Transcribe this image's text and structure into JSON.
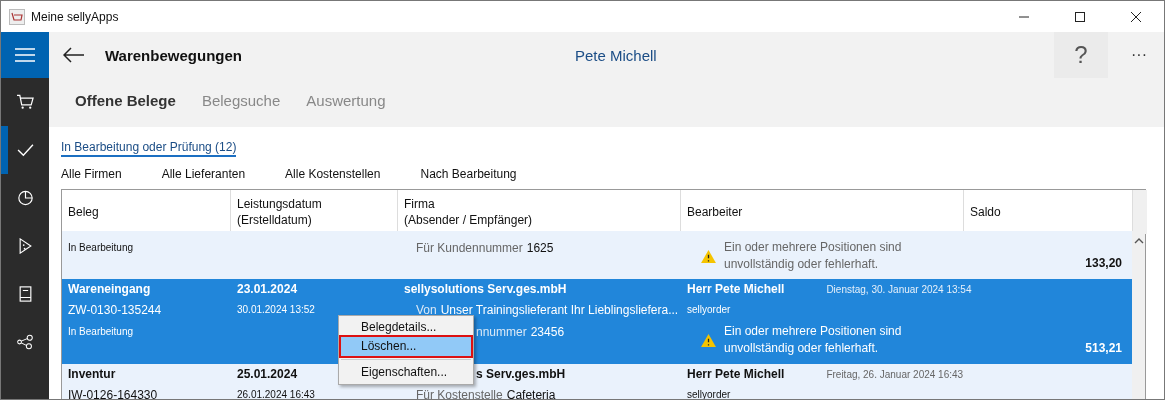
{
  "window": {
    "title": "Meine sellyApps"
  },
  "sidebar": {
    "items": [
      {
        "kind": "menu",
        "selected": false
      },
      {
        "kind": "cart",
        "selected": false
      },
      {
        "kind": "check",
        "selected": true
      },
      {
        "kind": "chart",
        "selected": false
      },
      {
        "kind": "slice",
        "selected": false
      },
      {
        "kind": "book",
        "selected": false
      },
      {
        "kind": "share",
        "selected": false
      }
    ]
  },
  "header": {
    "title": "Warenbewegungen",
    "user": "Pete Michell",
    "help": "?",
    "more": "···"
  },
  "tabs": [
    {
      "label": "Offene Belege",
      "selected": true
    },
    {
      "label": "Belegsuche",
      "selected": false
    },
    {
      "label": "Auswertung",
      "selected": false
    }
  ],
  "view": {
    "label": "In Bearbeitung oder Prüfung (12)"
  },
  "filters": [
    "Alle Firmen",
    "Alle Lieferanten",
    "Alle Kostenstellen",
    "Nach Bearbeitung"
  ],
  "table": {
    "columns": [
      {
        "label": "Beleg"
      },
      {
        "label": "Leistungsdatum",
        "sublabel": "(Erstelldatum)"
      },
      {
        "label": "Firma",
        "sublabel": "(Absender / Empfänger)"
      },
      {
        "label": "Bearbeiter"
      },
      {
        "label": "Saldo"
      }
    ],
    "rows": [
      {
        "selected": false,
        "status": "In Bearbeitung",
        "reference": {
          "label": "Für Kundennummer",
          "value": "1625"
        },
        "warning": "Ein oder mehrere Positionen sind unvollständig oder fehlerhaft.",
        "saldo": "133,20"
      },
      {
        "selected": true,
        "type": "Wareneingang",
        "number": "ZW-0130-135244",
        "status": "In Bearbeitung",
        "date": "23.01.2024",
        "created": "30.01.2024 13:52",
        "company": "sellysolutions Serv.ges.mbH",
        "sender": {
          "label": "Von",
          "value": "Unser Trainingslieferant Ihr Lieblingsliefera..."
        },
        "reference": {
          "label": "nnummer",
          "value": "23456"
        },
        "editor": "Herr Pete Michell",
        "edited": "Dienstag, 30. Januar 2024 13:54",
        "user": "sellyorder",
        "warning": "Ein oder mehrere Positionen sind unvollständig oder fehlerhaft.",
        "saldo": "513,21"
      },
      {
        "selected": false,
        "type": "Inventur",
        "number": "IW-0126-164330",
        "date": "25.01.2024",
        "created": "26.01.2024 16:43",
        "company": "s Serv.ges.mbH",
        "reference": {
          "label": "Für Kostenstelle",
          "value": "Cafeteria"
        },
        "editor": "Herr Pete Michell",
        "edited": "Freitag, 26. Januar 2024 16:43",
        "user": "sellyorder"
      }
    ]
  },
  "context_menu": {
    "items": [
      {
        "label": "Belegdetails...",
        "selected": false
      },
      {
        "label": "Löschen...",
        "selected": true
      },
      {
        "label": "Eigenschaften...",
        "selected": false,
        "separated": true
      }
    ]
  }
}
